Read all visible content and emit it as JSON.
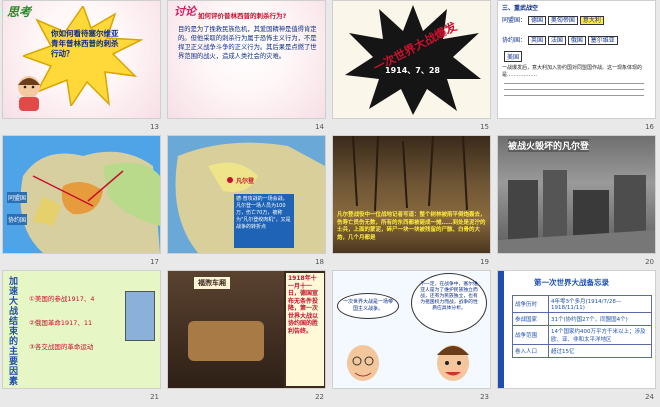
{
  "slides": [
    {
      "num": "13",
      "tag": "思考",
      "question": "你如何看待塞尔维亚青年普林西普的刺杀行动？"
    },
    {
      "num": "14",
      "tag": "讨论",
      "heading": "如何评价普林西普的刺杀行为?",
      "body": "目的是为了挽救民族危机，其爱国精神是值得肯定的。但他采取的刺杀行为属于恐怖主义行为，不是捍卫正义战争斗争的正义行为。其后果是点燃了世界范围的战火，造成人类社会的灾难。"
    },
    {
      "num": "15",
      "title_line1": "一次世界大战爆发",
      "date": "1914、7、28"
    },
    {
      "num": "16",
      "section": "三、重武战空",
      "row1_label": "同盟国：",
      "row1_items": [
        "德国",
        "奥匈帝国",
        "意大利"
      ],
      "row2_label": "协约国：",
      "row2_items": [
        "英国",
        "法国",
        "俄国",
        "塞尔维亚"
      ],
      "row2_sub": "美国",
      "note": "一战爆发后，意大利加入协约国对同盟国作战。这一现象体现的是………………"
    },
    {
      "num": "17",
      "map_labels": [
        "同盟国",
        "协约国"
      ]
    },
    {
      "num": "18",
      "map_label": "凡尔登",
      "caption": "德·普攻战的一场会战，凡尔登一场人员为100万，伤亡70万，被称为\"凡尔登绞肉机\"，又是战争的转折点"
    },
    {
      "num": "19",
      "caption": "凡尔登战役中一位战地记者写道：整个树林被雨平倒炮轰去，伤寿亡员伤无数，所有的东西都被砸成一摊……到处是泥泞的士兵，上面的蒙泥，碎尸一块一块被残留的尸骸、白骨的大炮，几个月都是"
    },
    {
      "num": "20",
      "title": "被战火毁坏的凡尔登"
    },
    {
      "num": "21",
      "vertical_title": "加速大战结束的主要因素",
      "items": [
        "①美国的参战1917、4",
        "②俄国革命1917、11",
        "③各交战国的革命运动"
      ]
    },
    {
      "num": "22",
      "sign": "福煦车厢",
      "caption": "1918年十一月十一日，德国宣布无条件投降，第一次世界大战以协约国的胜利告终。"
    },
    {
      "num": "23",
      "bubble_left": "一次世界大战是一场帝国主义战争。",
      "bubble_right": "不一定，在战争中，塞尔维亚人是为了维护民族独立而战，还有为民族独立，也有为祖国权力而战，战争的性质应具体分析。"
    },
    {
      "num": "24",
      "title": "第一次世界大战备忘录",
      "rows": [
        {
          "label": "战争历时",
          "value": "4年零3个多月(1914/7/28—1918/11/11)"
        },
        {
          "label": "参战国家",
          "value": "31个(协约国27个，同盟国4个)"
        },
        {
          "label": "战争范围",
          "value": "14个国家约400万平方千米以上；涉及欧、亚、非和太平洋地区"
        },
        {
          "label": "卷入人口",
          "value": "超过15亿"
        }
      ]
    }
  ],
  "colors": {
    "title_red": "#c8102e",
    "text_blue": "#0b2c8a",
    "highlight_yellow": "#ffeb3b"
  }
}
